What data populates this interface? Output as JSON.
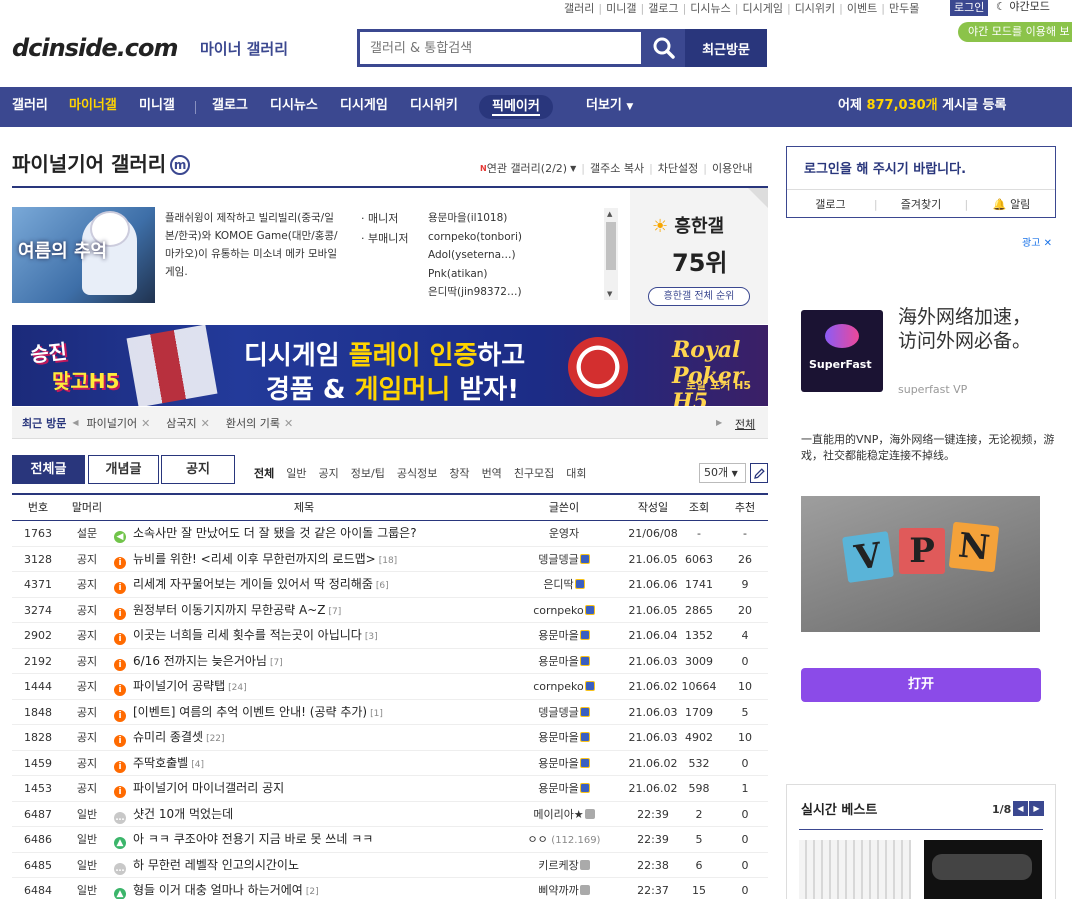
{
  "top_links": [
    "갤러리",
    "미니갤",
    "갤로그",
    "디시뉴스",
    "디시게임",
    "디시위키",
    "이벤트",
    "만두몰"
  ],
  "top_login": "로그인",
  "night_mode": "야간모드",
  "night_tooltip": "야간 모드를 이용해 보",
  "logo": "dcinside.com",
  "logo_sub": "마이너 갤러리",
  "search": {
    "placeholder": "갤러리 & 통합검색",
    "recent_btn": "최근방문"
  },
  "nav": {
    "items": [
      "갤러리",
      "마이너갤",
      "미니갤",
      "갤로그",
      "디시뉴스",
      "디시게임",
      "디시위키",
      "픽메이커",
      "더보기"
    ],
    "stat_prefix": "어제",
    "stat_num": "877,030개",
    "stat_suffix": "게시글 등록"
  },
  "gallery": {
    "title": "파이널기어 갤러리",
    "mark": "m",
    "links": [
      "연관 갤러리(2/2)",
      "갤주소 복사",
      "차단설정",
      "이용안내"
    ],
    "thumb_text": "여름의 추억",
    "description": "플래쉬윙이 제작하고 빌리빌리(중국/일본/한국)와 KOMOE Game(대만/홍콩/마카오)이 유통하는 미소녀 메카 모바일 게임.",
    "manager_label": "· 매니저",
    "sub_manager_label": "· 부매니저",
    "managers": [
      "용문마을(il1018)",
      "cornpeko(tonbori)",
      "Adol(yseterna…)",
      "Pnk(atikan)",
      "은디딱(jin98372…)"
    ],
    "rank_title": "흥한갤",
    "rank_num": "75위",
    "rank_btn": "흥한갤 전체 순위"
  },
  "banner": {
    "left1": "승진",
    "left2": "맞고H5",
    "line1a": "디시게임 ",
    "line1b": "플레이 인증",
    "line1c": "하고",
    "line2a": "경품 & ",
    "line2b": "게임머니",
    "line2c": " 받자!",
    "right1": "Royal Poker H5",
    "right2": "로얄 포커 H5"
  },
  "recent": {
    "label": "최근 방문",
    "items": [
      "파이널기어",
      "삼국지",
      "환서의 기록"
    ],
    "all": "전체"
  },
  "tabs": [
    "전체글",
    "개념글",
    "공지"
  ],
  "subcats": [
    "전체",
    "일반",
    "공지",
    "정보/팁",
    "공식정보",
    "창작",
    "번역",
    "친구모집",
    "대회"
  ],
  "per_page": "50개",
  "table": {
    "headers": [
      "번호",
      "말머리",
      "제목",
      "글쓴이",
      "작성일",
      "조회",
      "추천"
    ],
    "rows": [
      {
        "no": "1763",
        "head": "설문",
        "icon": "survey",
        "title": "소속사만 잘 만났어도 더 잘 됐을 것 같은 아이돌 그룹은?",
        "cnt": "",
        "writer": "운영자",
        "badge": "",
        "date": "21/06/08",
        "views": "-",
        "rec": "-"
      },
      {
        "no": "3128",
        "head": "공지",
        "icon": "notice",
        "title": "뉴비를 위한! <리세 이후 무한런까지의 로드맵>",
        "cnt": "[18]",
        "writer": "뎅글뎅글",
        "badge": "y",
        "date": "21.06.05",
        "views": "6063",
        "rec": "26"
      },
      {
        "no": "4371",
        "head": "공지",
        "icon": "notice",
        "title": "리세계 자꾸물어보는 게이들 있어서 딱 정리해줌",
        "cnt": "[6]",
        "writer": "은디딱",
        "badge": "y",
        "date": "21.06.06",
        "views": "1741",
        "rec": "9"
      },
      {
        "no": "3274",
        "head": "공지",
        "icon": "notice",
        "title": "원정부터 이동기지까지 무한공략 A~Z",
        "cnt": "[7]",
        "writer": "cornpeko",
        "badge": "y",
        "date": "21.06.05",
        "views": "2865",
        "rec": "20"
      },
      {
        "no": "2902",
        "head": "공지",
        "icon": "notice",
        "title": "이곳는 너희들 리세 횟수를 적는곳이 아닙니다",
        "cnt": "[3]",
        "writer": "용문마을",
        "badge": "y",
        "date": "21.06.04",
        "views": "1352",
        "rec": "4"
      },
      {
        "no": "2192",
        "head": "공지",
        "icon": "notice",
        "title": "6/16 전까지는 늦은거아님",
        "cnt": "[7]",
        "writer": "용문마을",
        "badge": "y",
        "date": "21.06.03",
        "views": "3009",
        "rec": "0"
      },
      {
        "no": "1444",
        "head": "공지",
        "icon": "notice",
        "title": "파이널기어 공략탭",
        "cnt": "[24]",
        "writer": "cornpeko",
        "badge": "y",
        "date": "21.06.02",
        "views": "10664",
        "rec": "10"
      },
      {
        "no": "1848",
        "head": "공지",
        "icon": "notice",
        "title": "[이벤트] 여름의 추억 이벤트 안내! (공략 추가)",
        "cnt": "[1]",
        "writer": "뎅글뎅글",
        "badge": "y",
        "date": "21.06.03",
        "views": "1709",
        "rec": "5"
      },
      {
        "no": "1828",
        "head": "공지",
        "icon": "notice",
        "title": "슈미리 종결셋",
        "cnt": "[22]",
        "writer": "용문마을",
        "badge": "y",
        "date": "21.06.03",
        "views": "4902",
        "rec": "10"
      },
      {
        "no": "1459",
        "head": "공지",
        "icon": "notice",
        "title": "주딱호출벨",
        "cnt": "[4]",
        "writer": "용문마을",
        "badge": "y",
        "date": "21.06.02",
        "views": "532",
        "rec": "0"
      },
      {
        "no": "1453",
        "head": "공지",
        "icon": "notice",
        "title": "파이널기어 마이너갤러리 공지",
        "cnt": "",
        "writer": "용문마을",
        "badge": "y",
        "date": "21.06.02",
        "views": "598",
        "rec": "1"
      },
      {
        "no": "6487",
        "head": "일반",
        "icon": "text",
        "title": "샷건 10개 먹었는데",
        "cnt": "",
        "writer": "메이리아★",
        "badge": "g",
        "date": "22:39",
        "views": "2",
        "rec": "0"
      },
      {
        "no": "6486",
        "head": "일반",
        "icon": "img",
        "title": "아 ㅋㅋ 쿠조아야 전용기 지금 바로 못 쓰네 ㅋㅋ",
        "cnt": "",
        "writer": "ㅇㅇ",
        "ip": "(112.169)",
        "badge": "",
        "date": "22:39",
        "views": "5",
        "rec": "0"
      },
      {
        "no": "6485",
        "head": "일반",
        "icon": "text",
        "title": "하 무한런 레벨작 인고의시간이노",
        "cnt": "",
        "writer": "키르케장",
        "badge": "g",
        "date": "22:38",
        "views": "6",
        "rec": "0"
      },
      {
        "no": "6484",
        "head": "일반",
        "icon": "img",
        "title": "형들 이거 대충 얼마나 하는거에여",
        "cnt": "[2]",
        "writer": "삐약까까",
        "badge": "g",
        "date": "22:37",
        "views": "15",
        "rec": "0"
      }
    ]
  },
  "right": {
    "login_msg": "로그인을 해 주시기 바랍니다.",
    "login_links": [
      "갤로그",
      "즐겨찾기",
      "알림"
    ],
    "ad_label": "광고 ✕",
    "ad_logo": "SuperFast",
    "ad_head": "海外网络加速，访问外网必备。",
    "ad_brand": "superfast VP",
    "ad_body": "一直能用的VNP，海外网络一键连接，无论视频，游戏，社交都能稳定连接不掉线。",
    "ad_blocks": [
      "V",
      "P",
      "N"
    ],
    "ad_btn": "打开",
    "best_title": "실시간 베스트",
    "best_page": "1/8"
  }
}
